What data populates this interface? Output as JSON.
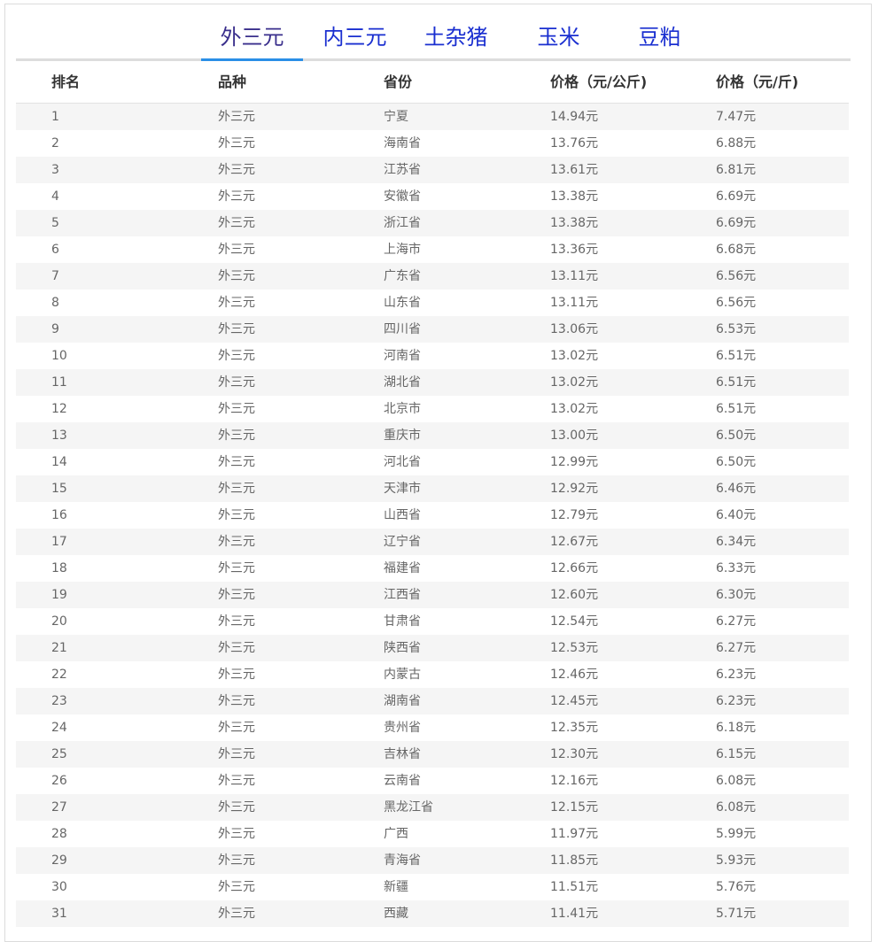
{
  "tabs": [
    {
      "label": "外三元",
      "active": true
    },
    {
      "label": "内三元",
      "active": false
    },
    {
      "label": "土杂猪",
      "active": false
    },
    {
      "label": "玉米",
      "active": false
    },
    {
      "label": "豆粕",
      "active": false
    }
  ],
  "table": {
    "headers": [
      "排名",
      "品种",
      "省份",
      "价格（元/公斤)",
      "价格（元/斤)"
    ],
    "rows": [
      [
        "1",
        "外三元",
        "宁夏",
        "14.94元",
        "7.47元"
      ],
      [
        "2",
        "外三元",
        "海南省",
        "13.76元",
        "6.88元"
      ],
      [
        "3",
        "外三元",
        "江苏省",
        "13.61元",
        "6.81元"
      ],
      [
        "4",
        "外三元",
        "安徽省",
        "13.38元",
        "6.69元"
      ],
      [
        "5",
        "外三元",
        "浙江省",
        "13.38元",
        "6.69元"
      ],
      [
        "6",
        "外三元",
        "上海市",
        "13.36元",
        "6.68元"
      ],
      [
        "7",
        "外三元",
        "广东省",
        "13.11元",
        "6.56元"
      ],
      [
        "8",
        "外三元",
        "山东省",
        "13.11元",
        "6.56元"
      ],
      [
        "9",
        "外三元",
        "四川省",
        "13.06元",
        "6.53元"
      ],
      [
        "10",
        "外三元",
        "河南省",
        "13.02元",
        "6.51元"
      ],
      [
        "11",
        "外三元",
        "湖北省",
        "13.02元",
        "6.51元"
      ],
      [
        "12",
        "外三元",
        "北京市",
        "13.02元",
        "6.51元"
      ],
      [
        "13",
        "外三元",
        "重庆市",
        "13.00元",
        "6.50元"
      ],
      [
        "14",
        "外三元",
        "河北省",
        "12.99元",
        "6.50元"
      ],
      [
        "15",
        "外三元",
        "天津市",
        "12.92元",
        "6.46元"
      ],
      [
        "16",
        "外三元",
        "山西省",
        "12.79元",
        "6.40元"
      ],
      [
        "17",
        "外三元",
        "辽宁省",
        "12.67元",
        "6.34元"
      ],
      [
        "18",
        "外三元",
        "福建省",
        "12.66元",
        "6.33元"
      ],
      [
        "19",
        "外三元",
        "江西省",
        "12.60元",
        "6.30元"
      ],
      [
        "20",
        "外三元",
        "甘肃省",
        "12.54元",
        "6.27元"
      ],
      [
        "21",
        "外三元",
        "陕西省",
        "12.53元",
        "6.27元"
      ],
      [
        "22",
        "外三元",
        "内蒙古",
        "12.46元",
        "6.23元"
      ],
      [
        "23",
        "外三元",
        "湖南省",
        "12.45元",
        "6.23元"
      ],
      [
        "24",
        "外三元",
        "贵州省",
        "12.35元",
        "6.18元"
      ],
      [
        "25",
        "外三元",
        "吉林省",
        "12.30元",
        "6.15元"
      ],
      [
        "26",
        "外三元",
        "云南省",
        "12.16元",
        "6.08元"
      ],
      [
        "27",
        "外三元",
        "黑龙江省",
        "12.15元",
        "6.08元"
      ],
      [
        "28",
        "外三元",
        "广西",
        "11.97元",
        "5.99元"
      ],
      [
        "29",
        "外三元",
        "青海省",
        "11.85元",
        "5.93元"
      ],
      [
        "30",
        "外三元",
        "新疆",
        "11.51元",
        "5.76元"
      ],
      [
        "31",
        "外三元",
        "西藏",
        "11.41元",
        "5.71元"
      ]
    ]
  }
}
